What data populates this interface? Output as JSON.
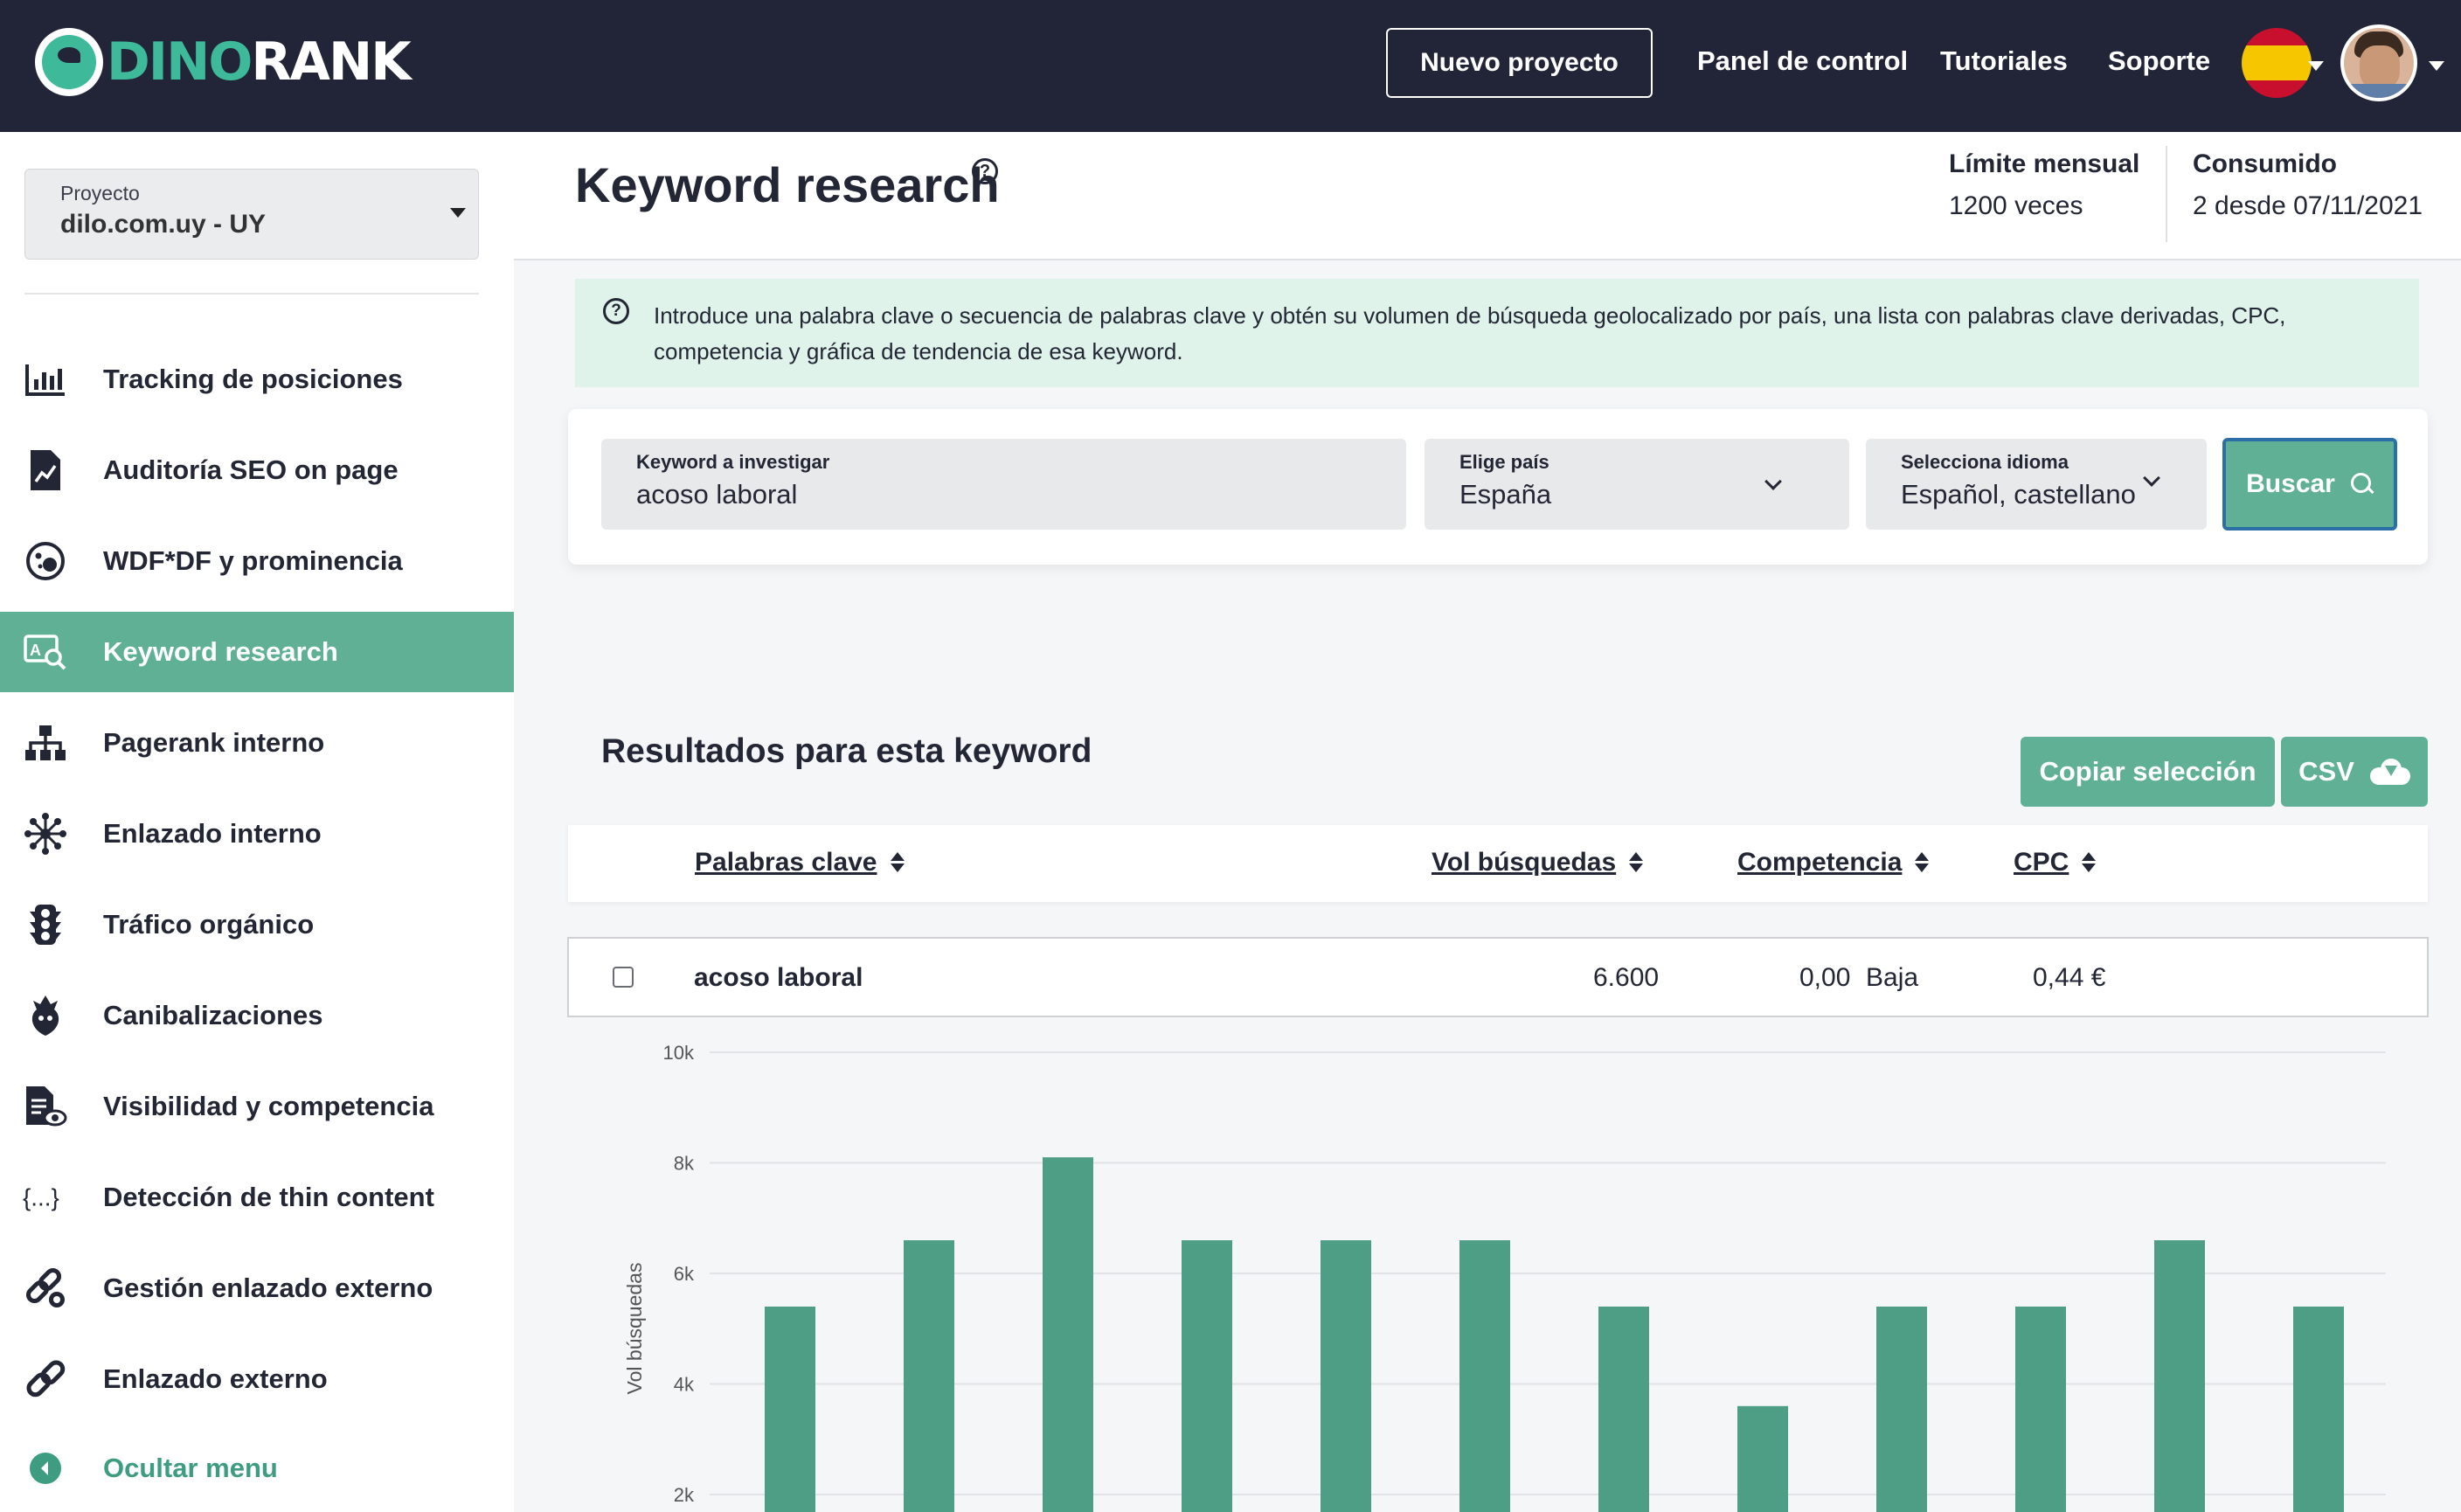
{
  "brand": {
    "part1": "DINO",
    "part2": "RANK",
    "accent": "#3eb99a"
  },
  "topnav": {
    "new_project": "Nuevo proyecto",
    "links": [
      "Panel de control",
      "Tutoriales",
      "Soporte"
    ],
    "language_flag": "spain-flag-icon",
    "avatar": "user-avatar"
  },
  "sidebar": {
    "project_label": "Proyecto",
    "project_value": "dilo.com.uy - UY",
    "items": [
      {
        "label": "Tracking de posiciones",
        "icon": "bar-chart-icon"
      },
      {
        "label": "Auditoría SEO on page",
        "icon": "document-chart-icon"
      },
      {
        "label": "WDF*DF y prominencia",
        "icon": "bubbles-icon"
      },
      {
        "label": "Keyword research",
        "icon": "keyword-search-icon"
      },
      {
        "label": "Pagerank interno",
        "icon": "sitemap-icon"
      },
      {
        "label": "Enlazado interno",
        "icon": "network-icon"
      },
      {
        "label": "Tráfico orgánico",
        "icon": "traffic-light-icon"
      },
      {
        "label": "Canibalizaciones",
        "icon": "cannibal-icon"
      },
      {
        "label": "Visibilidad y competencia",
        "icon": "document-eye-icon"
      },
      {
        "label": "Detección de thin content",
        "icon": "braces-icon"
      },
      {
        "label": "Gestión enlazado externo",
        "icon": "link-gear-icon"
      },
      {
        "label": "Enlazado externo",
        "icon": "link-icon"
      }
    ],
    "hide_menu": "Ocultar menu"
  },
  "header": {
    "title": "Keyword research",
    "limit_label": "Límite mensual",
    "limit_value": "1200 veces",
    "consumed_label": "Consumido",
    "consumed_value": "2 desde 07/11/2021"
  },
  "banner": {
    "text": "Introduce una palabra clave o secuencia de palabras clave y obtén su volumen de búsqueda geolocalizado por país, una lista con palabras clave derivadas, CPC, competencia y gráfica de tendencia de esa keyword."
  },
  "search": {
    "keyword_label": "Keyword a investigar",
    "keyword_value": "acoso laboral",
    "country_label": "Elige país",
    "country_value": "España",
    "language_label": "Selecciona idioma",
    "language_value": "Español, castellano",
    "button": "Buscar"
  },
  "results": {
    "title": "Resultados para esta keyword",
    "copy_button": "Copiar selección",
    "csv_button": "CSV",
    "columns": [
      "Palabras clave",
      "Vol búsquedas",
      "Competencia",
      "CPC"
    ],
    "row": {
      "keyword": "acoso laboral",
      "volume": "6.600",
      "competition_value": "0,00",
      "competition_level": "Baja",
      "cpc": "0,44 €"
    }
  },
  "chart_data": {
    "type": "bar",
    "ylabel": "Vol búsquedas",
    "y_ticks": [
      "10k",
      "8k",
      "6k",
      "4k",
      "2k"
    ],
    "ylim": [
      1600,
      10000
    ],
    "values": [
      5400,
      6600,
      8100,
      6600,
      6600,
      6600,
      5400,
      3600,
      5400,
      5400,
      6600,
      5400
    ],
    "bar_color": "#4e9e85",
    "grid": true
  }
}
